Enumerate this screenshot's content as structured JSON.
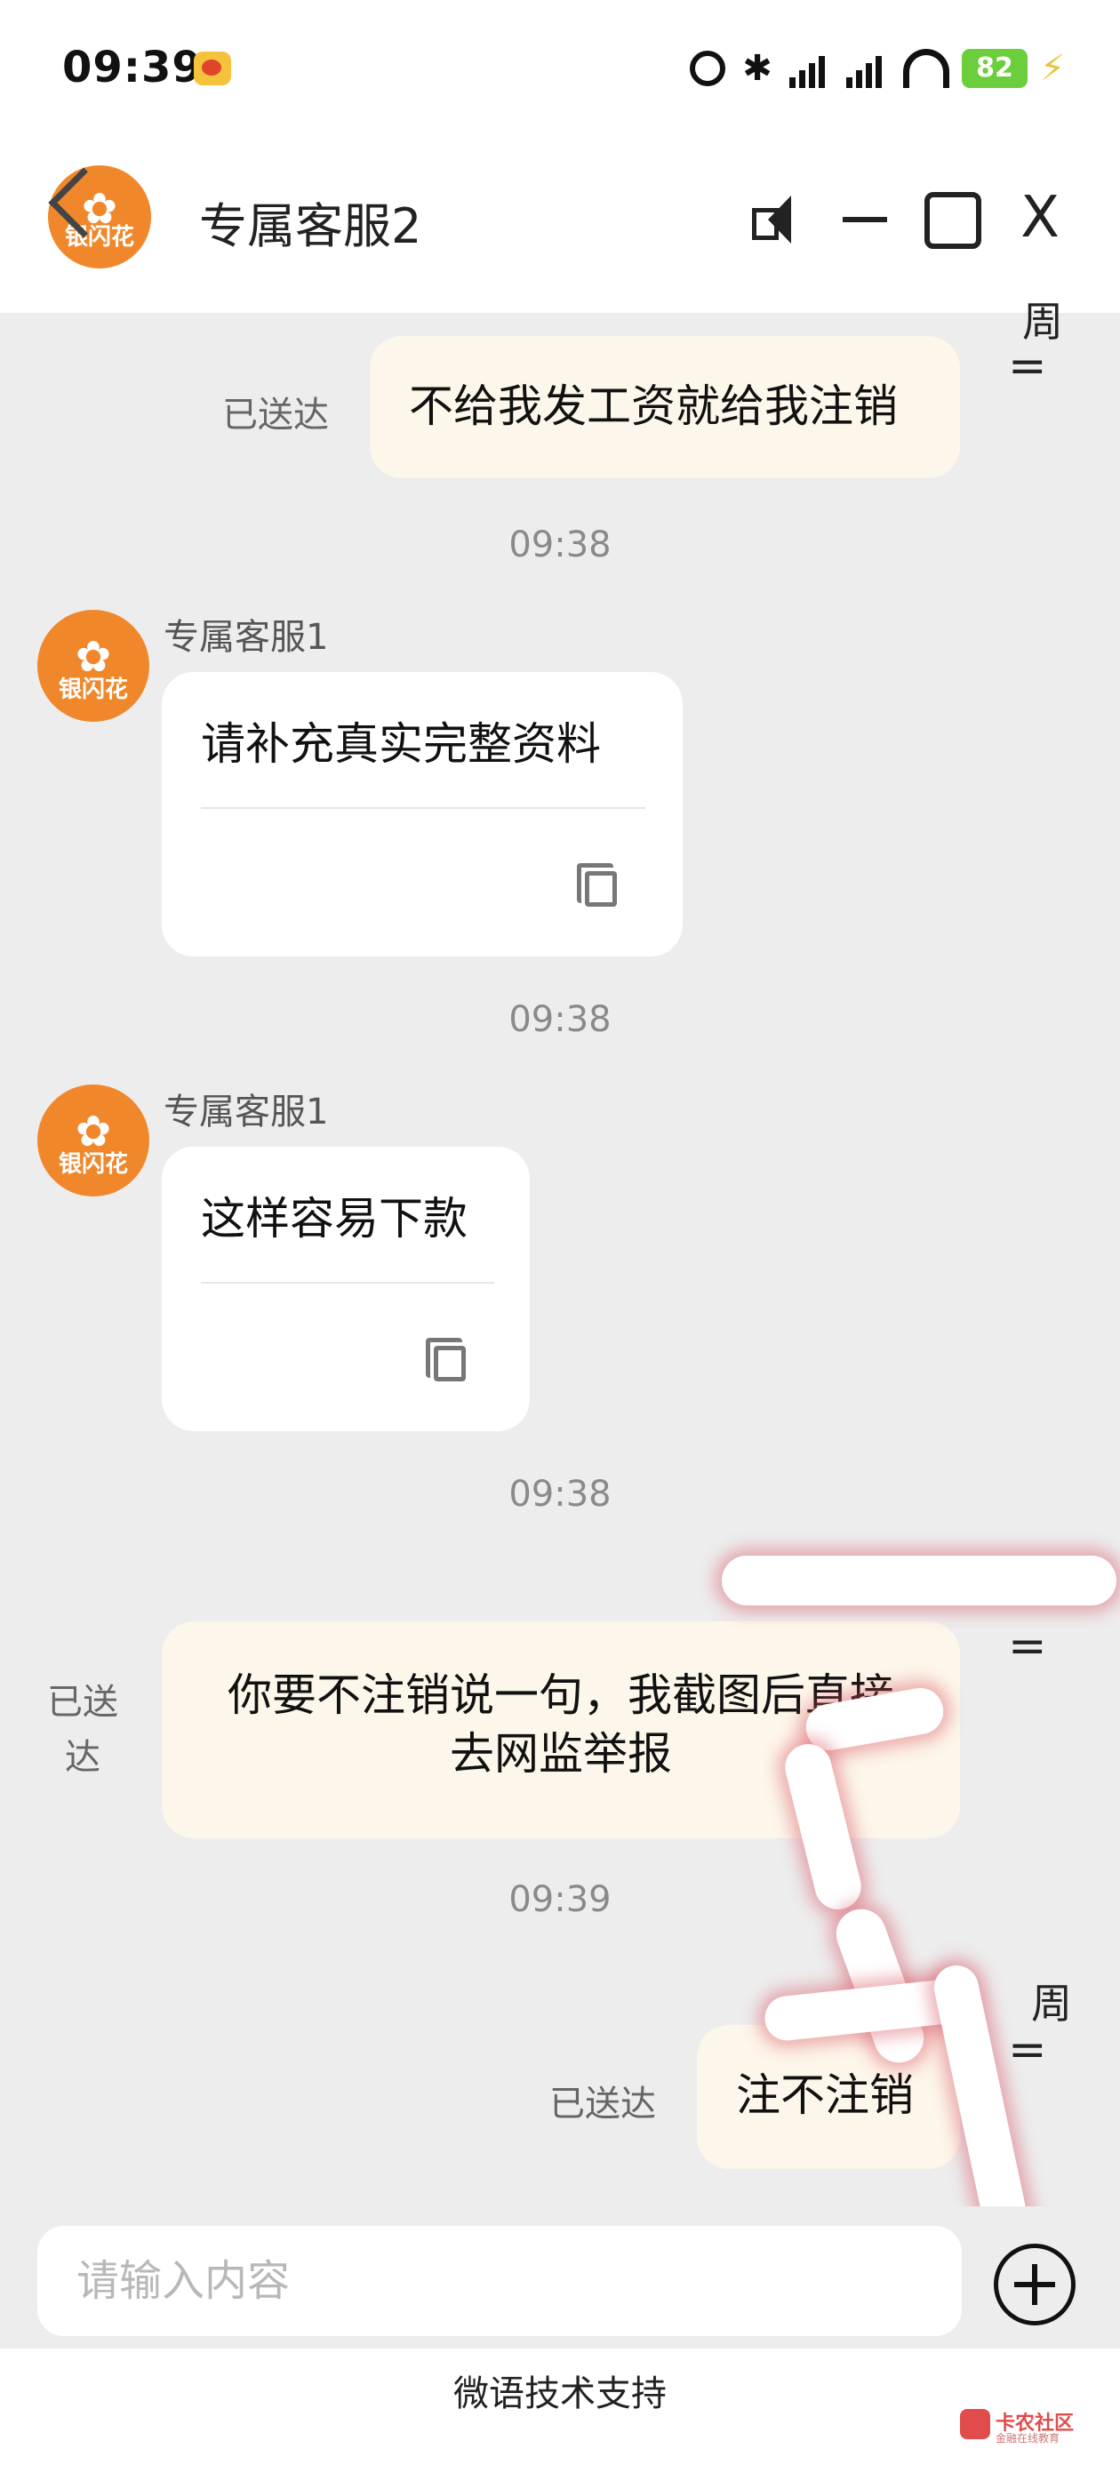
{
  "status_bar": {
    "time": "09:39",
    "battery": "82"
  },
  "header": {
    "title": "专属客服2",
    "avatar_text": "银闪花"
  },
  "messages": {
    "m1": {
      "text": "不给我发工资就给我注销",
      "status": "已送达"
    },
    "t1": "09:38",
    "m2": {
      "sender": "专属客服1",
      "text": "请补充真实完整资料",
      "avatar_text": "银闪花"
    },
    "t2": "09:38",
    "m3": {
      "sender": "专属客服1",
      "text": "这样容易下款",
      "avatar_text": "银闪花"
    },
    "t3": "09:38",
    "m4": {
      "line1": "你要不注销说一句，我截图后直接",
      "line2": "去网监举报",
      "status_line1": "已送",
      "status_line2": "达"
    },
    "t4": "09:39",
    "m5": {
      "text": "注不注销",
      "status": "已送达"
    }
  },
  "side_marks": {
    "g1": "周",
    "g2": "周",
    "eq": "="
  },
  "input": {
    "placeholder": "请输入内容"
  },
  "footer": {
    "text": "微语技术支持"
  },
  "watermark": {
    "title": "卡农社区",
    "subtitle": "金融在线教育"
  }
}
